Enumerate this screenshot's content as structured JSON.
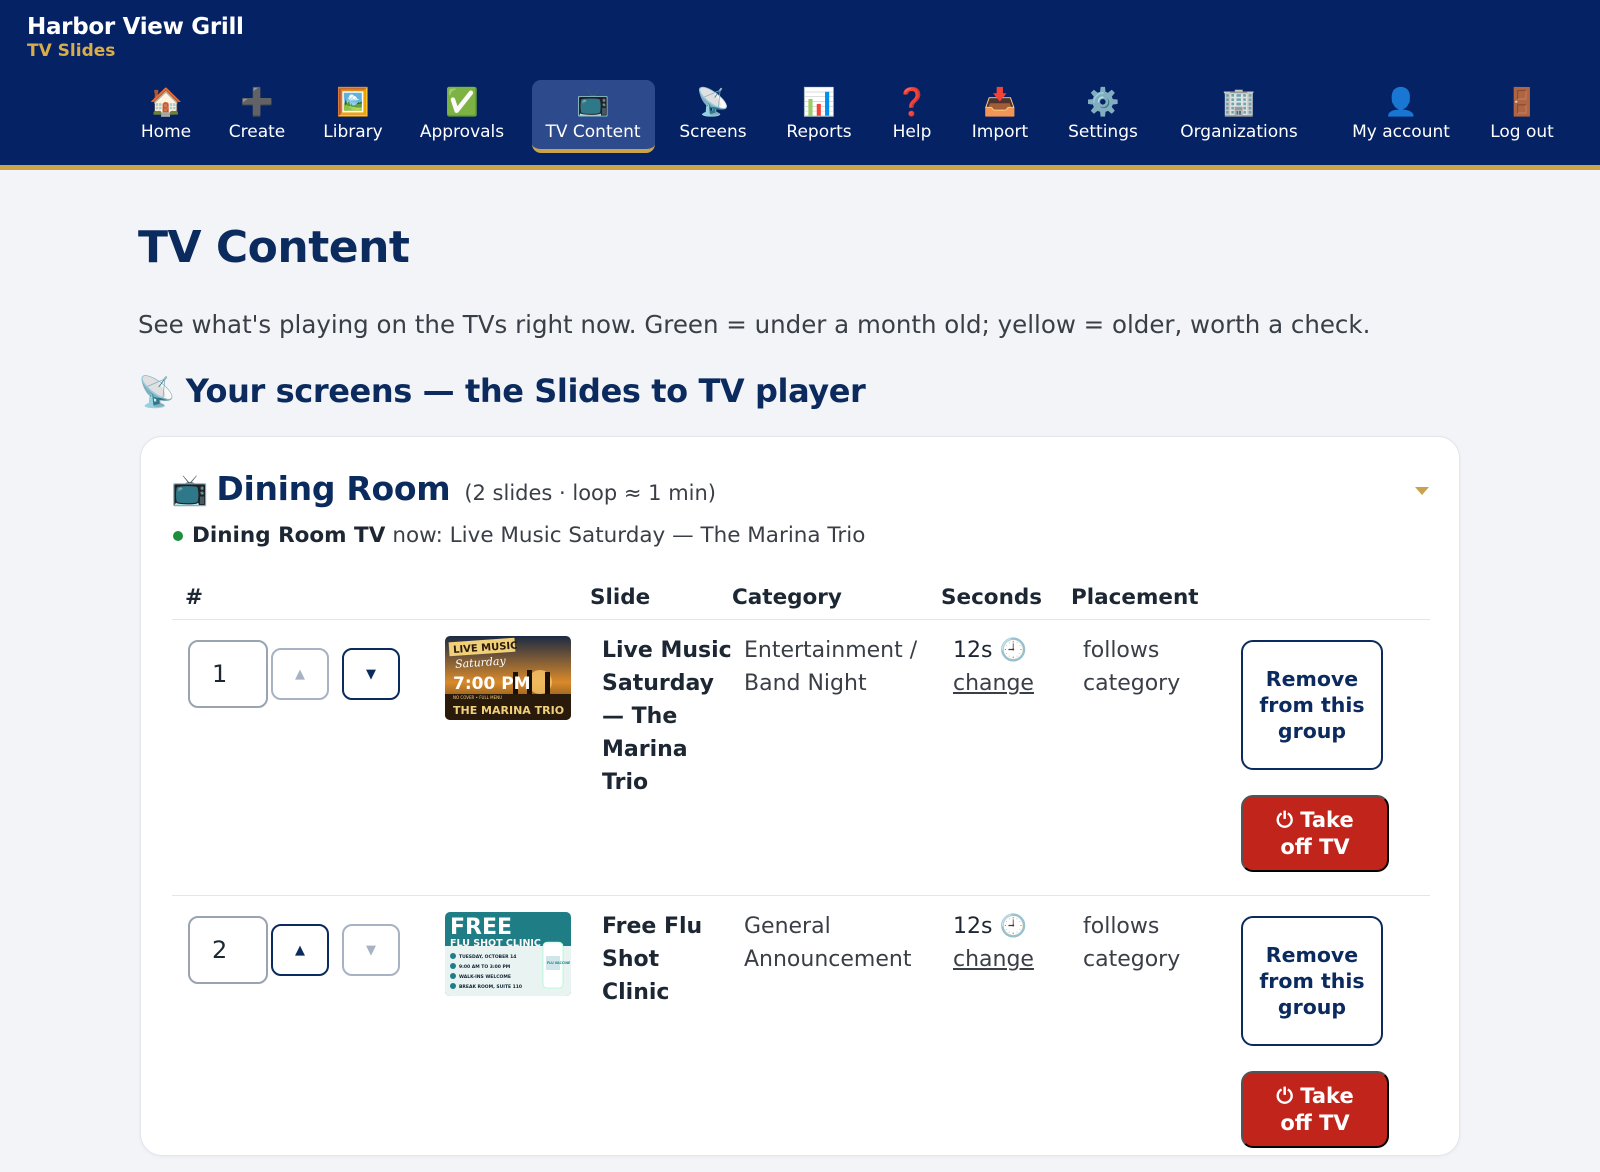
{
  "brand": {
    "name": "Harbor View Grill",
    "subtitle": "TV Slides"
  },
  "nav": [
    {
      "icon": "🏠",
      "icon_name": "home-icon",
      "label": "Home"
    },
    {
      "icon": "➕",
      "icon_name": "plus-icon",
      "label": "Create"
    },
    {
      "icon": "🖼️",
      "icon_name": "picture-icon",
      "label": "Library"
    },
    {
      "icon": "✅",
      "icon_name": "checkmark-icon",
      "label": "Approvals"
    },
    {
      "icon": "📺",
      "icon_name": "tv-icon",
      "label": "TV Content",
      "active": true
    },
    {
      "icon": "📡",
      "icon_name": "satellite-dish-icon",
      "label": "Screens"
    },
    {
      "icon": "📊",
      "icon_name": "bar-chart-icon",
      "label": "Reports"
    },
    {
      "icon": "❓",
      "icon_name": "question-mark-icon",
      "label": "Help"
    },
    {
      "icon": "📥",
      "icon_name": "inbox-tray-icon",
      "label": "Import"
    },
    {
      "icon": "⚙️",
      "icon_name": "gear-icon",
      "label": "Settings"
    },
    {
      "icon": "🏢",
      "icon_name": "office-building-icon",
      "label": "Organizations"
    },
    {
      "icon": "👤",
      "icon_name": "user-icon",
      "label": "My account"
    },
    {
      "icon": "🚪",
      "icon_name": "door-icon",
      "label": "Log out"
    }
  ],
  "page": {
    "title": "TV Content",
    "intro": "See what's playing on the TVs right now. Green = under a month old; yellow = older, worth a check.",
    "section_icon": "📡",
    "section_title": "Your screens — the Slides to TV player"
  },
  "group": {
    "icon": "📺",
    "name": "Dining Room",
    "meta": "(2 slides · loop ≈ 1 min)",
    "now_screen": "Dining Room TV",
    "now_text": "now: Live Music Saturday — The Marina Trio",
    "headers": {
      "order": "#",
      "slide": "Slide",
      "category": "Category",
      "seconds": "Seconds",
      "placement": "Placement"
    },
    "rows": [
      {
        "order": "1",
        "up_arrow": "▲",
        "down_arrow": "▼",
        "up_enabled": false,
        "down_enabled": true,
        "thumb": {
          "line1": "LIVE MUSIC",
          "line2": "Saturday",
          "line3": "7:00 PM",
          "line4": "NO COVER • FULL MENU",
          "line5": "THE MARINA TRIO"
        },
        "slide": "Live Music Saturday — The Marina Trio",
        "category": "Entertainment / Band Night",
        "seconds": "12s",
        "clock": "🕘",
        "change": "change",
        "placement": "follows category",
        "remove_label": "Remove from this group",
        "takeoff_icon": "⏻",
        "takeoff_label": "Take off TV"
      },
      {
        "order": "2",
        "up_arrow": "▲",
        "down_arrow": "▼",
        "up_enabled": true,
        "down_enabled": false,
        "thumb": {
          "line1": "FREE",
          "line2": "FLU SHOT CLINIC",
          "line3": "TUESDAY, OCTOBER 14",
          "line4": "9:00 AM TO 3:00 PM",
          "line5": "WALK-INS WELCOME",
          "line6": "BREAK ROOM, SUITE 110",
          "badge": "FLU VACCINE"
        },
        "slide": "Free Flu Shot Clinic",
        "category": "General Announcement",
        "seconds": "12s",
        "clock": "🕘",
        "change": "change",
        "placement": "follows category",
        "remove_label": "Remove from this group",
        "takeoff_icon": "⏻",
        "takeoff_label": "Take off TV"
      }
    ]
  },
  "colors": {
    "header_bg": "#052264",
    "accent_gold": "#c9a24a",
    "title_navy": "#0b2a5e",
    "danger_red": "#c0241a",
    "live_green": "#1e8e3e"
  }
}
